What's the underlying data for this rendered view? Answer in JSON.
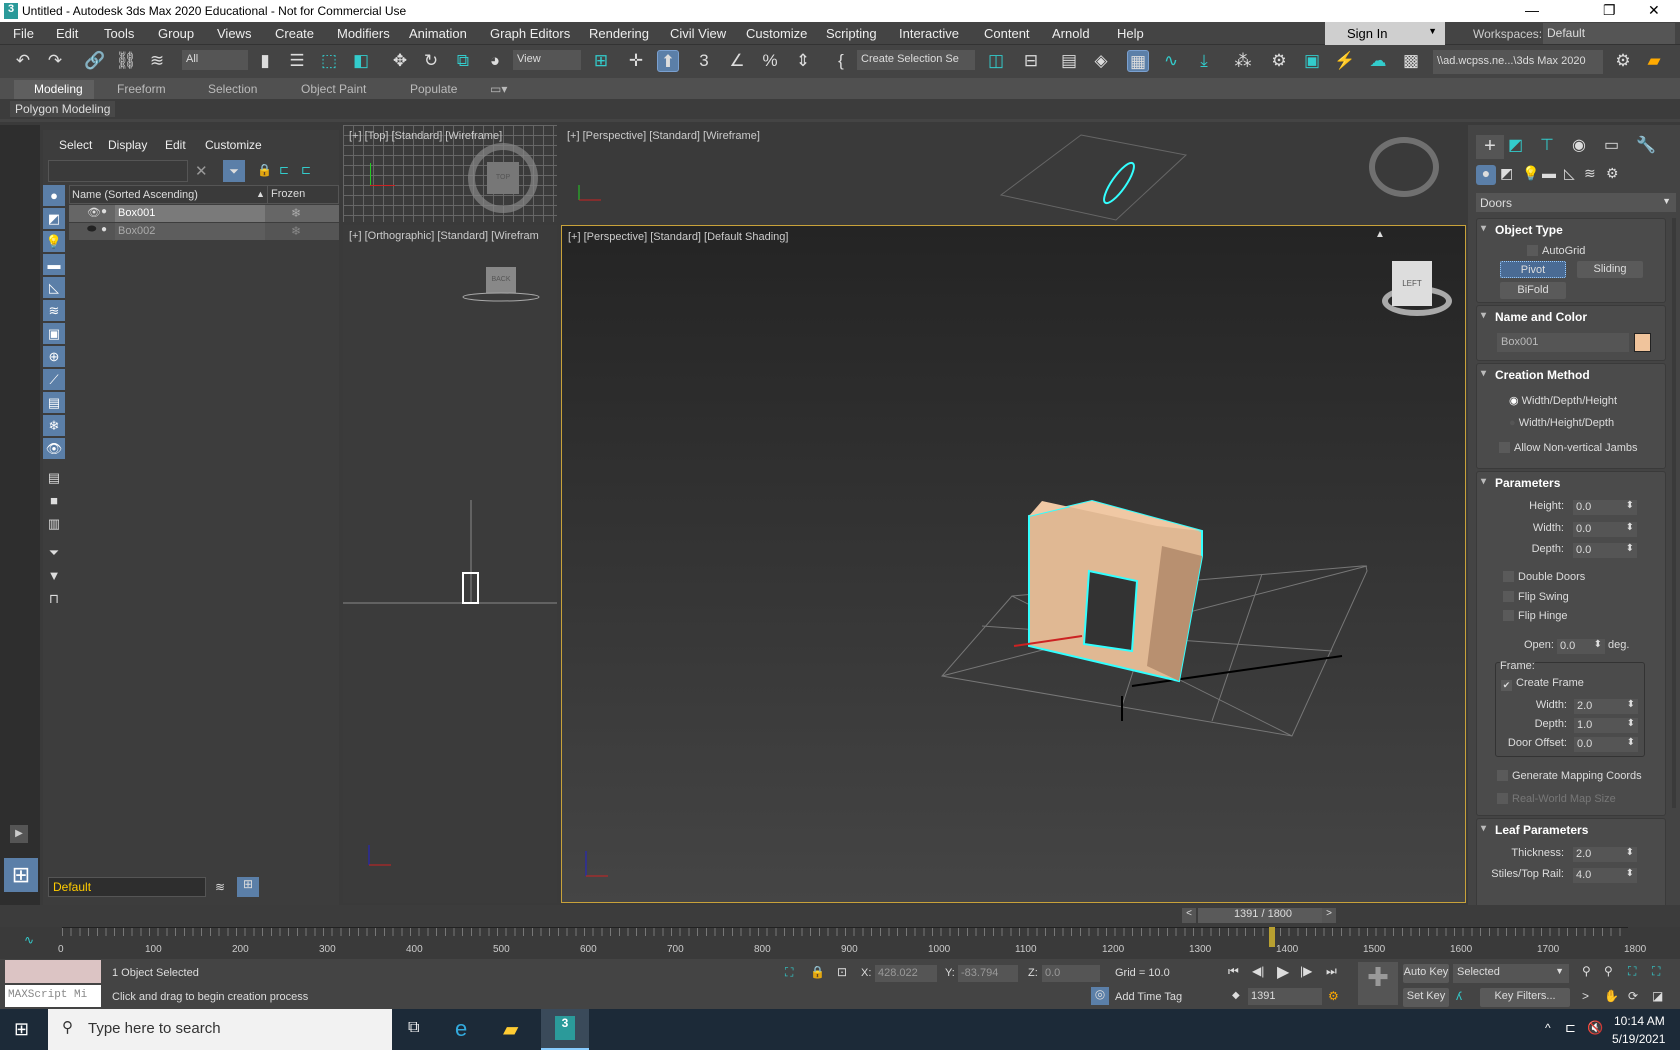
{
  "window": {
    "title": "Untitled - Autodesk 3ds Max 2020 Educational - Not for Commercial Use",
    "minimize": "—",
    "restore": "❐",
    "close": "✕"
  },
  "menu": [
    "File",
    "Edit",
    "Tools",
    "Group",
    "Views",
    "Create",
    "Modifiers",
    "Animation",
    "Graph Editors",
    "Rendering",
    "Civil View",
    "Customize",
    "Scripting",
    "Interactive",
    "Content",
    "Arnold",
    "Help"
  ],
  "signin": "Sign In",
  "workspaces": {
    "label": "Workspaces:",
    "value": "Default"
  },
  "toolbar": {
    "filter": "All",
    "ref_coord": "View",
    "selection_set": "Create Selection Se",
    "project_path": "\\\\ad.wcpss.ne...\\3ds Max 2020"
  },
  "ribbon": {
    "tabs": [
      "Modeling",
      "Freeform",
      "Selection",
      "Object Paint",
      "Populate"
    ],
    "active": "Modeling",
    "panel": "Polygon Modeling"
  },
  "explorer": {
    "menu": [
      "Select",
      "Display",
      "Edit",
      "Customize"
    ],
    "search_placeholder": "",
    "col_name": "Name (Sorted Ascending)",
    "col_frozen": "Frozen",
    "rows": [
      {
        "name": "Box001",
        "selected": true
      },
      {
        "name": "Box002",
        "selected": false
      }
    ],
    "layer": "Default"
  },
  "viewports": {
    "top": "[+] [Top] [Standard] [Wireframe]",
    "persp_wire": "[+] [Perspective] [Standard] [Wireframe]",
    "ortho": "[+] [Orthographic] [Standard] [Wirefram",
    "persp_main": "[+] [Perspective] [Standard] [Default Shading]"
  },
  "cmdpanel": {
    "category": "Doors",
    "object_type": {
      "title": "Object Type",
      "autogrid": "AutoGrid",
      "buttons": [
        "Pivot",
        "Sliding",
        "BiFold"
      ],
      "active": "Pivot"
    },
    "name_color": {
      "title": "Name and Color",
      "name": "Box001",
      "color": "#f0c49c"
    },
    "creation": {
      "title": "Creation Method",
      "options": [
        "Width/Depth/Height",
        "Width/Height/Depth"
      ],
      "selected": "Width/Depth/Height",
      "jambs": "Allow Non-vertical Jambs"
    },
    "params": {
      "title": "Parameters",
      "height_label": "Height:",
      "height": "0.0",
      "width_label": "Width:",
      "width": "0.0",
      "depth_label": "Depth:",
      "depth": "0.0",
      "double": "Double Doors",
      "flip_swing": "Flip Swing",
      "flip_hinge": "Flip Hinge",
      "open_label": "Open:",
      "open": "0.0",
      "deg": "deg.",
      "frame": "Frame:",
      "create_frame": "Create Frame",
      "fwidth_label": "Width:",
      "fwidth": "2.0",
      "fdepth_label": "Depth:",
      "fdepth": "1.0",
      "offset_label": "Door Offset:",
      "offset": "0.0",
      "mapping": "Generate Mapping Coords",
      "realworld": "Real-World Map Size"
    },
    "leaf": {
      "title": "Leaf Parameters",
      "thick_label": "Thickness:",
      "thick": "2.0",
      "stiles_label": "Stiles/Top Rail:",
      "stiles": "4.0"
    }
  },
  "timeline": {
    "frame": "1391 / 1800",
    "current": 1391,
    "total": 1800,
    "ticks": [
      "0",
      "100",
      "200",
      "300",
      "400",
      "500",
      "600",
      "700",
      "800",
      "900",
      "1000",
      "1100",
      "1200",
      "1300",
      "1400",
      "1500",
      "1600",
      "1700",
      "1800"
    ]
  },
  "status": {
    "maxscript": "MAXScript Mi",
    "selected": "1 Object Selected",
    "prompt": "Click and drag to begin creation process",
    "x_label": "X:",
    "x": "428.022",
    "y_label": "Y:",
    "y": "-83.794",
    "z_label": "Z:",
    "z": "0.0",
    "grid": "Grid = 10.0",
    "add_time_tag": "Add Time Tag",
    "auto_key": "Auto Key",
    "set_key": "Set Key",
    "key_mode": "Selected",
    "key_filters": "Key Filters...",
    "frame": "1391"
  },
  "taskbar": {
    "search": "Type here to search",
    "time": "10:14 AM",
    "date": "5/19/2021"
  }
}
